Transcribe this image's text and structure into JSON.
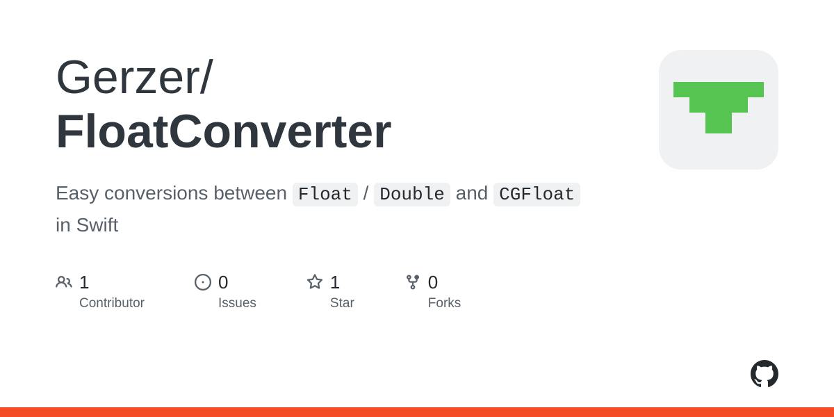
{
  "title": {
    "owner": "Gerzer",
    "separator": "/",
    "repo": "FloatConverter"
  },
  "description": {
    "prefix": "Easy conversions between ",
    "code1": "Float",
    "sep1": " / ",
    "code2": "Double",
    "mid": " and ",
    "code3": "CGFloat",
    "suffix": " in Swift"
  },
  "stats": {
    "contributors": {
      "value": "1",
      "label": "Contributor"
    },
    "issues": {
      "value": "0",
      "label": "Issues"
    },
    "stars": {
      "value": "1",
      "label": "Star"
    },
    "forks": {
      "value": "0",
      "label": "Forks"
    }
  },
  "colors": {
    "accent": "#f34c27",
    "avatar_green": "#55c451"
  }
}
